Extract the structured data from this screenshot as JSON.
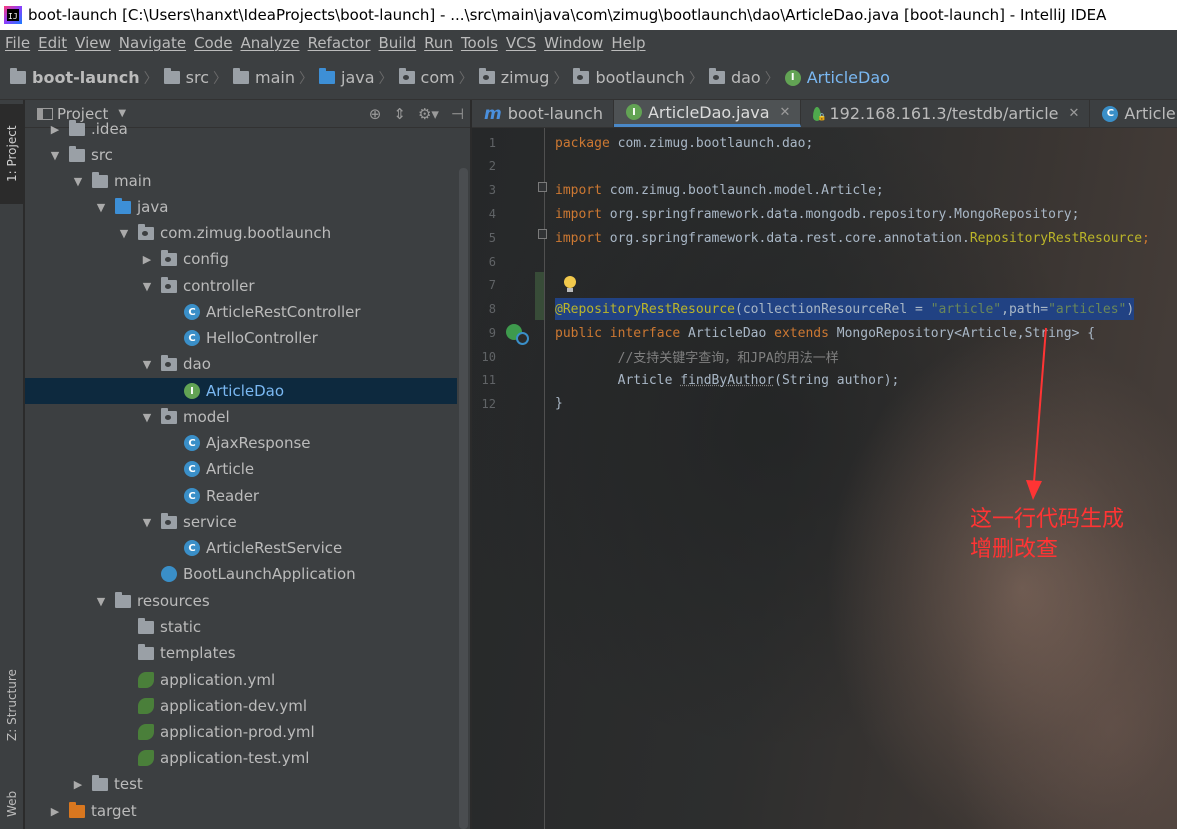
{
  "window": {
    "title": "boot-launch [C:\\Users\\hanxt\\IdeaProjects\\boot-launch] - ...\\src\\main\\java\\com\\zimug\\bootlaunch\\dao\\ArticleDao.java [boot-launch] - IntelliJ IDEA"
  },
  "menu": [
    "File",
    "Edit",
    "View",
    "Navigate",
    "Code",
    "Analyze",
    "Refactor",
    "Build",
    "Run",
    "Tools",
    "VCS",
    "Window",
    "Help"
  ],
  "breadcrumbs": [
    {
      "label": "boot-launch",
      "icon": "folder-icon"
    },
    {
      "label": "src",
      "icon": "folder-icon"
    },
    {
      "label": "main",
      "icon": "folder-icon"
    },
    {
      "label": "java",
      "icon": "folder-blue-icon"
    },
    {
      "label": "com",
      "icon": "package-icon"
    },
    {
      "label": "zimug",
      "icon": "package-icon"
    },
    {
      "label": "bootlaunch",
      "icon": "package-icon"
    },
    {
      "label": "dao",
      "icon": "package-icon"
    },
    {
      "label": "ArticleDao",
      "icon": "interface-icon"
    }
  ],
  "left_strip": {
    "project_tab": "1: Project",
    "structure_tab": "Z: Structure",
    "web_tab": "Web"
  },
  "project_panel": {
    "title": "Project",
    "tree": [
      {
        "label": ".idea",
        "depth": 1,
        "arrow": "right",
        "icon": "folder"
      },
      {
        "label": "src",
        "depth": 1,
        "arrow": "down",
        "icon": "folder"
      },
      {
        "label": "main",
        "depth": 2,
        "arrow": "down",
        "icon": "folder"
      },
      {
        "label": "java",
        "depth": 3,
        "arrow": "down",
        "icon": "folder-blue"
      },
      {
        "label": "com.zimug.bootlaunch",
        "depth": 4,
        "arrow": "down",
        "icon": "package"
      },
      {
        "label": "config",
        "depth": 5,
        "arrow": "right",
        "icon": "package"
      },
      {
        "label": "controller",
        "depth": 5,
        "arrow": "down",
        "icon": "package"
      },
      {
        "label": "ArticleRestController",
        "depth": 6,
        "arrow": "",
        "icon": "class"
      },
      {
        "label": "HelloController",
        "depth": 6,
        "arrow": "",
        "icon": "class"
      },
      {
        "label": "dao",
        "depth": 5,
        "arrow": "down",
        "icon": "package"
      },
      {
        "label": "ArticleDao",
        "depth": 6,
        "arrow": "",
        "icon": "interface",
        "selected": true
      },
      {
        "label": "model",
        "depth": 5,
        "arrow": "down",
        "icon": "package"
      },
      {
        "label": "AjaxResponse",
        "depth": 6,
        "arrow": "",
        "icon": "class"
      },
      {
        "label": "Article",
        "depth": 6,
        "arrow": "",
        "icon": "class"
      },
      {
        "label": "Reader",
        "depth": 6,
        "arrow": "",
        "icon": "class"
      },
      {
        "label": "service",
        "depth": 5,
        "arrow": "down",
        "icon": "package"
      },
      {
        "label": "ArticleRestService",
        "depth": 6,
        "arrow": "",
        "icon": "class"
      },
      {
        "label": "BootLaunchApplication",
        "depth": 5,
        "arrow": "",
        "icon": "spring-class"
      },
      {
        "label": "resources",
        "depth": 3,
        "arrow": "down",
        "icon": "folder-resources"
      },
      {
        "label": "static",
        "depth": 4,
        "arrow": "",
        "icon": "folder"
      },
      {
        "label": "templates",
        "depth": 4,
        "arrow": "",
        "icon": "folder"
      },
      {
        "label": "application.yml",
        "depth": 4,
        "arrow": "",
        "icon": "spring-yml"
      },
      {
        "label": "application-dev.yml",
        "depth": 4,
        "arrow": "",
        "icon": "spring-yml"
      },
      {
        "label": "application-prod.yml",
        "depth": 4,
        "arrow": "",
        "icon": "spring-yml"
      },
      {
        "label": "application-test.yml",
        "depth": 4,
        "arrow": "",
        "icon": "spring-yml"
      },
      {
        "label": "test",
        "depth": 2,
        "arrow": "right",
        "icon": "folder"
      },
      {
        "label": "target",
        "depth": 1,
        "arrow": "right",
        "icon": "folder-orange"
      }
    ]
  },
  "editor": {
    "tabs": [
      {
        "label": "boot-launch",
        "icon": "maven-icon",
        "active": false,
        "closable": false
      },
      {
        "label": "ArticleDao.java",
        "icon": "interface-icon",
        "active": true,
        "closable": true
      },
      {
        "label": "192.168.161.3/testdb/article",
        "icon": "mongo-icon",
        "active": false,
        "closable": true
      },
      {
        "label": "ArticleRest",
        "icon": "class-icon",
        "active": false,
        "closable": false
      }
    ],
    "line_numbers": [
      "1",
      "2",
      "3",
      "4",
      "5",
      "6",
      "7",
      "8",
      "9",
      "10",
      "11",
      "12"
    ],
    "code": {
      "l1_kw": "package",
      "l1_rest": " com.zimug.bootlaunch.dao;",
      "l3_kw": "import",
      "l3_rest": " com.zimug.bootlaunch.model.Article;",
      "l4_kw": "import",
      "l4_rest": " org.springframework.data.mongodb.repository.MongoRepository;",
      "l5_kw": "import",
      "l5_rest": " org.springframework.data.rest.core.annotation.",
      "l5_ann": "RepositoryRestResource",
      "l5_end": ";",
      "l8_ann": "@RepositoryRestResource",
      "l8_a": "(collectionResourceRel = ",
      "l8_s1": "\"article\"",
      "l8_b": ",path=",
      "l8_s2": "\"articles\"",
      "l8_c": ")",
      "l9_kw1": "public interface",
      "l9_a": " ArticleDao ",
      "l9_kw2": "extends",
      "l9_b": " MongoRepository<Article,String> {",
      "l10_cmt": "        //支持关键字查询，和JPA的用法一样",
      "l11_a": "        Article ",
      "l11_method": "findByAuthor",
      "l11_b": "(String author);",
      "l12": "}"
    },
    "annotation_line1": "这一行代码生成",
    "annotation_line2": "增删改查",
    "annotation_color": "#ff3434"
  }
}
